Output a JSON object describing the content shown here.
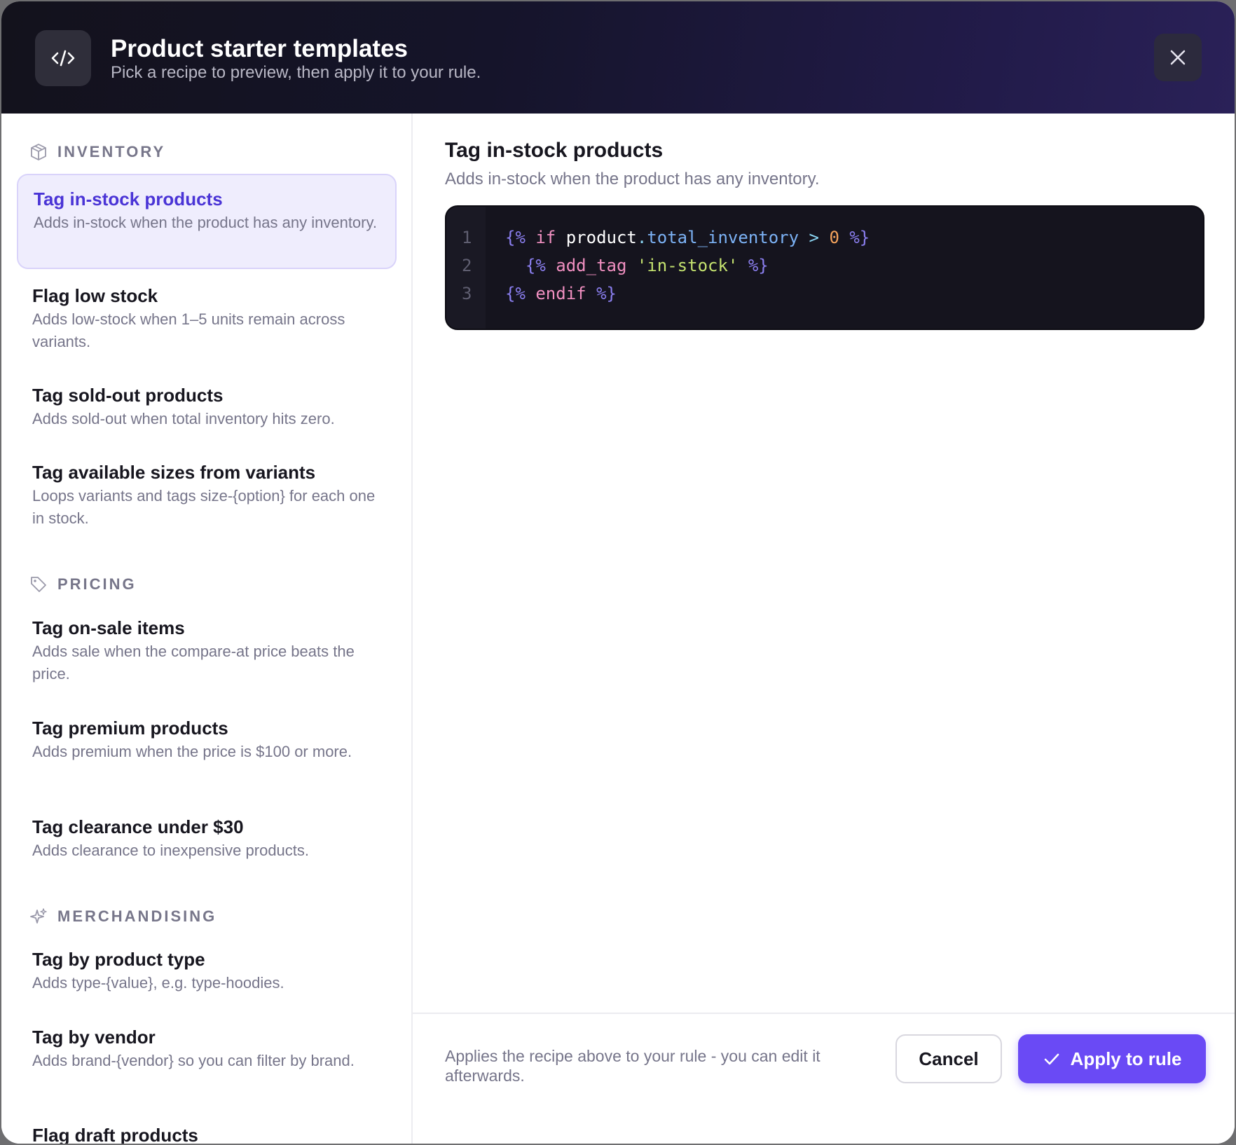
{
  "header": {
    "title": "Product starter templates",
    "subtitle": "Pick a recipe to preview, then apply it to your rule.",
    "icon": "code-icon",
    "close_icon": "close-icon"
  },
  "sidebar": {
    "sections": [
      {
        "label": "INVENTORY",
        "icon": "box-icon",
        "items": [
          {
            "title": "Tag in-stock products",
            "desc": "Adds in-stock when the product has any inventory.",
            "active": true
          },
          {
            "title": "Flag low stock",
            "desc": "Adds low-stock when 1–5 units remain across variants."
          },
          {
            "title": "Tag sold-out products",
            "desc": "Adds sold-out when total inventory hits zero."
          },
          {
            "title": "Tag available sizes from variants",
            "desc": "Loops variants and tags size-{option} for each one in stock."
          }
        ]
      },
      {
        "label": "PRICING",
        "icon": "tag-icon",
        "items": [
          {
            "title": "Tag on-sale items",
            "desc": "Adds sale when the compare-at price beats the price."
          },
          {
            "title": "Tag premium products",
            "desc": "Adds premium when the price is $100 or more."
          },
          {
            "title": "Tag clearance under $30",
            "desc": "Adds clearance to inexpensive products."
          }
        ]
      },
      {
        "label": "MERCHANDISING",
        "icon": "sparkle-icon",
        "items": [
          {
            "title": "Tag by product type",
            "desc": "Adds type-{value}, e.g. type-hoodies."
          },
          {
            "title": "Tag by vendor",
            "desc": "Adds brand-{vendor} so you can filter by brand."
          },
          {
            "title": "Flag draft products",
            "desc": ""
          }
        ]
      }
    ]
  },
  "preview": {
    "title": "Tag in-stock products",
    "desc": "Adds in-stock when the product has any inventory.",
    "line_numbers": [
      "1",
      "2",
      "3"
    ],
    "code": {
      "l1": {
        "open": "{%",
        "kw": "if",
        "obj": "product",
        "dot": ".",
        "attr": "total_inventory",
        "op": ">",
        "num": "0",
        "close": "%}"
      },
      "l2": {
        "open": "{%",
        "fn": "add_tag",
        "str": "'in-stock'",
        "close": "%}"
      },
      "l3": {
        "open": "{%",
        "kw": "endif",
        "close": "%}"
      }
    }
  },
  "footer": {
    "note": "Applies the recipe above to your rule - you can edit it afterwards.",
    "cancel_label": "Cancel",
    "apply_label": "Apply to rule",
    "apply_icon": "check-icon"
  },
  "colors": {
    "accent": "#6a4af5",
    "active_text": "#4a34d6",
    "active_bg": "#efedfd"
  }
}
